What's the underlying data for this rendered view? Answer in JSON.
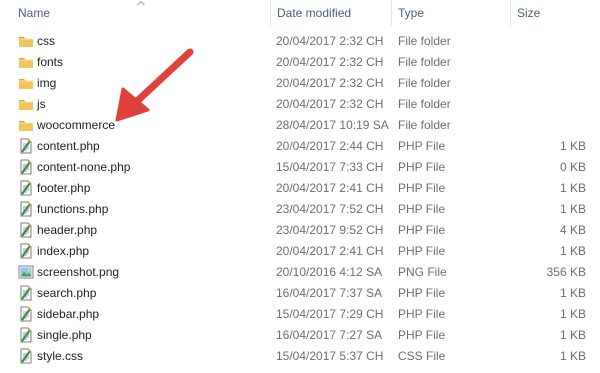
{
  "columns": {
    "name": "Name",
    "date_modified": "Date modified",
    "type": "Type",
    "size": "Size"
  },
  "files": [
    {
      "name": "css",
      "date": "20/04/2017 2:32 CH",
      "type": "File folder",
      "size": "",
      "icon": "folder-icon"
    },
    {
      "name": "fonts",
      "date": "20/04/2017 2:32 CH",
      "type": "File folder",
      "size": "",
      "icon": "folder-icon"
    },
    {
      "name": "img",
      "date": "20/04/2017 2:32 CH",
      "type": "File folder",
      "size": "",
      "icon": "folder-icon"
    },
    {
      "name": "js",
      "date": "20/04/2017 2:32 CH",
      "type": "File folder",
      "size": "",
      "icon": "folder-icon"
    },
    {
      "name": "woocommerce",
      "date": "28/04/2017 10:19 SA",
      "type": "File folder",
      "size": "",
      "icon": "folder-icon"
    },
    {
      "name": "content.php",
      "date": "20/04/2017 2:44 CH",
      "type": "PHP File",
      "size": "1 KB",
      "icon": "php-file-icon"
    },
    {
      "name": "content-none.php",
      "date": "15/04/2017 7:33 CH",
      "type": "PHP File",
      "size": "0 KB",
      "icon": "php-file-icon"
    },
    {
      "name": "footer.php",
      "date": "20/04/2017 2:41 CH",
      "type": "PHP File",
      "size": "1 KB",
      "icon": "php-file-icon"
    },
    {
      "name": "functions.php",
      "date": "23/04/2017 7:52 CH",
      "type": "PHP File",
      "size": "1 KB",
      "icon": "php-file-icon"
    },
    {
      "name": "header.php",
      "date": "23/04/2017 9:52 CH",
      "type": "PHP File",
      "size": "4 KB",
      "icon": "php-file-icon"
    },
    {
      "name": "index.php",
      "date": "20/04/2017 2:41 CH",
      "type": "PHP File",
      "size": "1 KB",
      "icon": "php-file-icon"
    },
    {
      "name": "screenshot.png",
      "date": "20/10/2016 4:12 SA",
      "type": "PNG File",
      "size": "356 KB",
      "icon": "image-file-icon"
    },
    {
      "name": "search.php",
      "date": "16/04/2017 7:37 SA",
      "type": "PHP File",
      "size": "1 KB",
      "icon": "php-file-icon"
    },
    {
      "name": "sidebar.php",
      "date": "15/04/2017 7:29 CH",
      "type": "PHP File",
      "size": "1 KB",
      "icon": "php-file-icon"
    },
    {
      "name": "single.php",
      "date": "16/04/2017 7:27 SA",
      "type": "PHP File",
      "size": "1 KB",
      "icon": "php-file-icon"
    },
    {
      "name": "style.css",
      "date": "15/04/2017 5:37 CH",
      "type": "CSS File",
      "size": "1 KB",
      "icon": "css-file-icon"
    }
  ],
  "colors": {
    "folder": "#e8b43c",
    "arrow": "#e0413a",
    "header_text": "#4c607a"
  }
}
